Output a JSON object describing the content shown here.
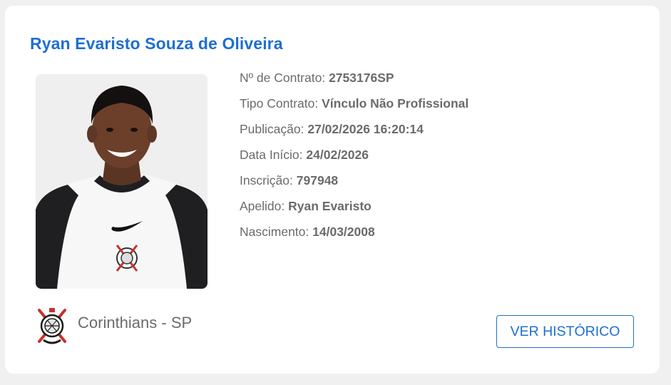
{
  "player": {
    "name": "Ryan Evaristo Souza de Oliveira"
  },
  "details": {
    "contract_label": "Nº de Contrato:",
    "contract_value": "2753176SP",
    "type_label": "Tipo Contrato:",
    "type_value": "Vínculo Não Profissional",
    "publication_label": "Publicação:",
    "publication_value": "27/02/2026 16:20:14",
    "start_label": "Data Início:",
    "start_value": "24/02/2026",
    "registration_label": "Inscrição:",
    "registration_value": "797948",
    "nickname_label": "Apelido:",
    "nickname_value": "Ryan Evaristo",
    "birth_label": "Nascimento:",
    "birth_value": "14/03/2008"
  },
  "club": {
    "name": "Corinthians - SP",
    "badge_icon": "corinthians-crest-icon"
  },
  "actions": {
    "history_label": "VER HISTÓRICO"
  },
  "colors": {
    "accent": "#1e6fd0",
    "text": "#6b6b6b",
    "card_bg": "#ffffff",
    "page_bg": "#f0f0f0"
  }
}
